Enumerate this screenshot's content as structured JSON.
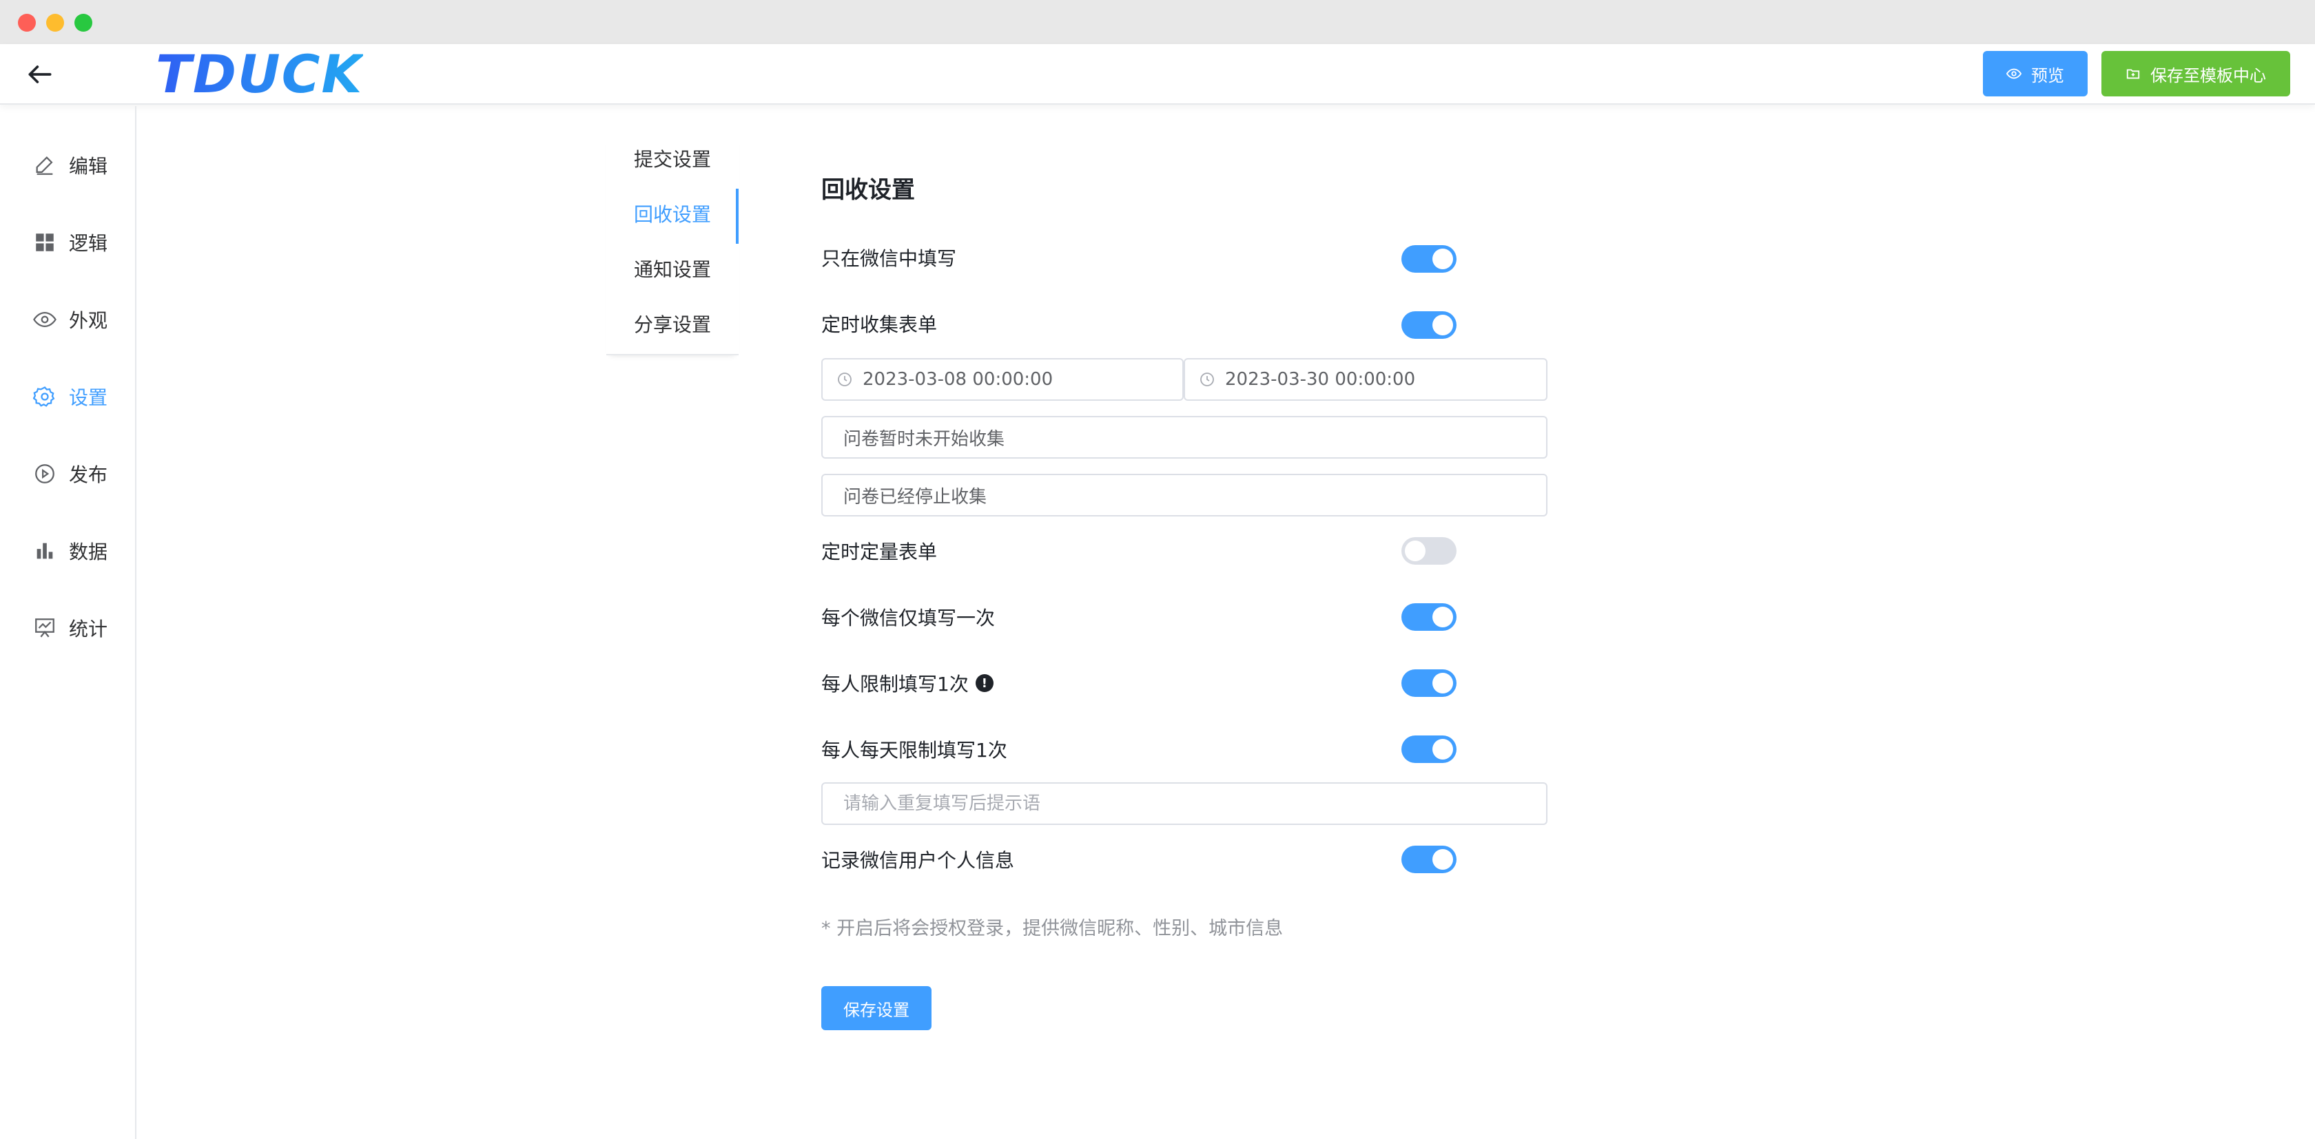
{
  "header": {
    "logo": "TDUCK",
    "preview_label": "预览",
    "save_template_label": "保存至模板中心"
  },
  "sidebar": {
    "items": [
      {
        "label": "编辑",
        "icon": "edit-icon"
      },
      {
        "label": "逻辑",
        "icon": "grid-icon"
      },
      {
        "label": "外观",
        "icon": "eye-icon"
      },
      {
        "label": "设置",
        "icon": "gear-icon",
        "active": true
      },
      {
        "label": "发布",
        "icon": "play-circle-icon"
      },
      {
        "label": "数据",
        "icon": "bar-chart-icon"
      },
      {
        "label": "统计",
        "icon": "stats-board-icon"
      }
    ]
  },
  "subnav": {
    "items": [
      {
        "label": "提交设置"
      },
      {
        "label": "回收设置",
        "active": true
      },
      {
        "label": "通知设置"
      },
      {
        "label": "分享设置"
      }
    ]
  },
  "settings": {
    "title": "回收设置",
    "wechat_only_label": "只在微信中填写",
    "wechat_only_on": true,
    "timed_collect_label": "定时收集表单",
    "timed_collect_on": true,
    "start_time": "2023-03-08 00:00:00",
    "end_time": "2023-03-30 00:00:00",
    "not_started_value": "问卷暂时未开始收集",
    "stopped_value": "问卷已经停止收集",
    "timed_quota_label": "定时定量表单",
    "timed_quota_on": false,
    "wechat_once_label": "每个微信仅填写一次",
    "wechat_once_on": true,
    "per_person_once_label": "每人限制填写1次",
    "per_person_once_on": true,
    "per_person_daily_label": "每人每天限制填写1次",
    "per_person_daily_on": true,
    "repeat_tip_placeholder": "请输入重复填写后提示语",
    "record_wechat_info_label": "记录微信用户个人信息",
    "record_wechat_info_on": true,
    "hint": "* 开启后将会授权登录，提供微信昵称、性别、城市信息",
    "save_label": "保存设置"
  },
  "colors": {
    "primary": "#409eff",
    "success": "#67c23a",
    "switch_off": "#dcdfe6"
  }
}
